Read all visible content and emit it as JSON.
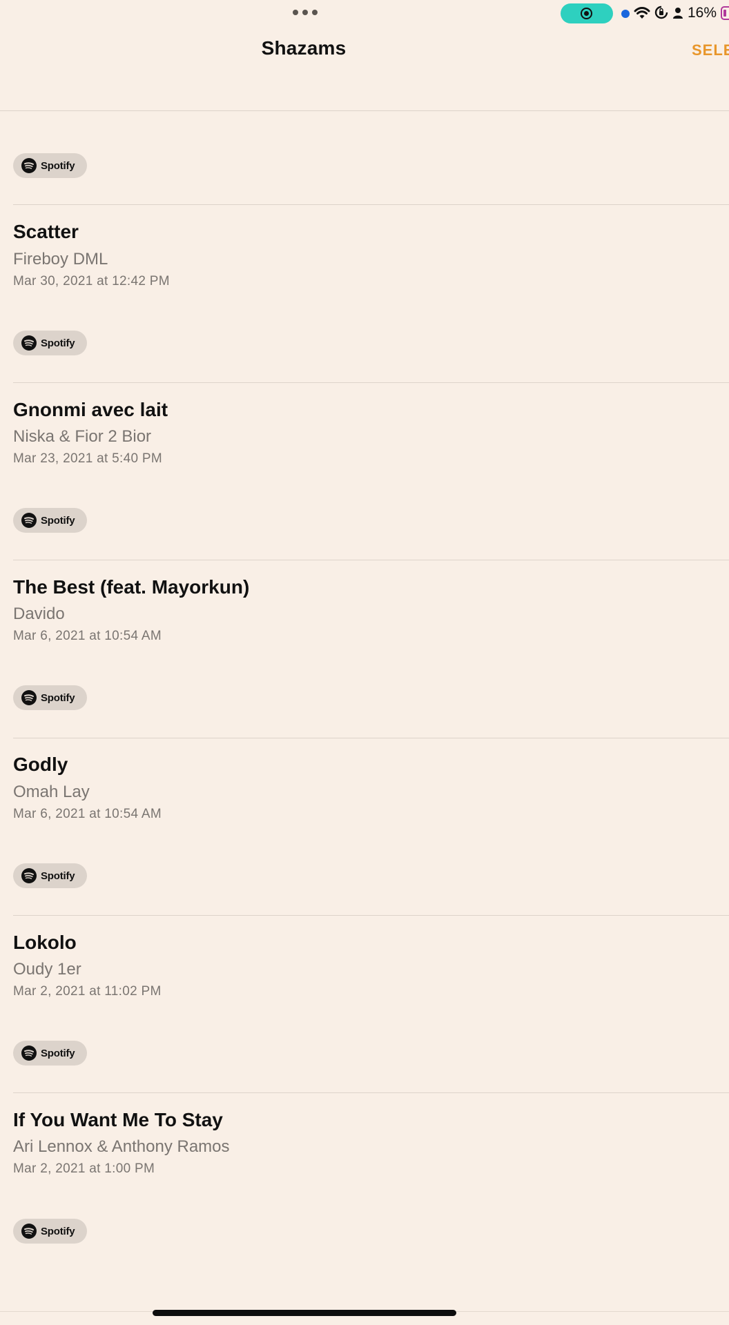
{
  "status_bar": {
    "battery_percent": "16%",
    "record_color": "#2ed0bf",
    "icons": [
      "screen-record-icon",
      "blue-dot-icon",
      "wifi-icon",
      "rotation-lock-icon",
      "person-icon",
      "battery-icon"
    ]
  },
  "header": {
    "title": "Shazams",
    "select_label": "SELE"
  },
  "spotify_label": "Spotify",
  "songs": [
    {
      "title": "Scatter",
      "artist": "Fireboy DML",
      "date": "Mar 30, 2021 at 12:42 PM"
    },
    {
      "title": "Gnonmi avec lait",
      "artist": "Niska & Fior 2 Bior",
      "date": "Mar 23, 2021 at 5:40 PM"
    },
    {
      "title": "The Best (feat. Mayorkun)",
      "artist": "Davido",
      "date": "Mar 6, 2021 at 10:54 AM"
    },
    {
      "title": "Godly",
      "artist": "Omah Lay",
      "date": "Mar 6, 2021 at 10:54 AM"
    },
    {
      "title": "Lokolo",
      "artist": "Oudy 1er",
      "date": "Mar 2, 2021 at 11:02 PM"
    },
    {
      "title": "If You Want Me To Stay",
      "artist": "Ari Lennox & Anthony Ramos",
      "date": "Mar 2, 2021 at 1:00 PM"
    }
  ],
  "colors": {
    "background": "#f9efe6",
    "accent": "#e8962b",
    "secondary_text": "#7a7571",
    "spotify_pill": "#dcd3cb"
  }
}
